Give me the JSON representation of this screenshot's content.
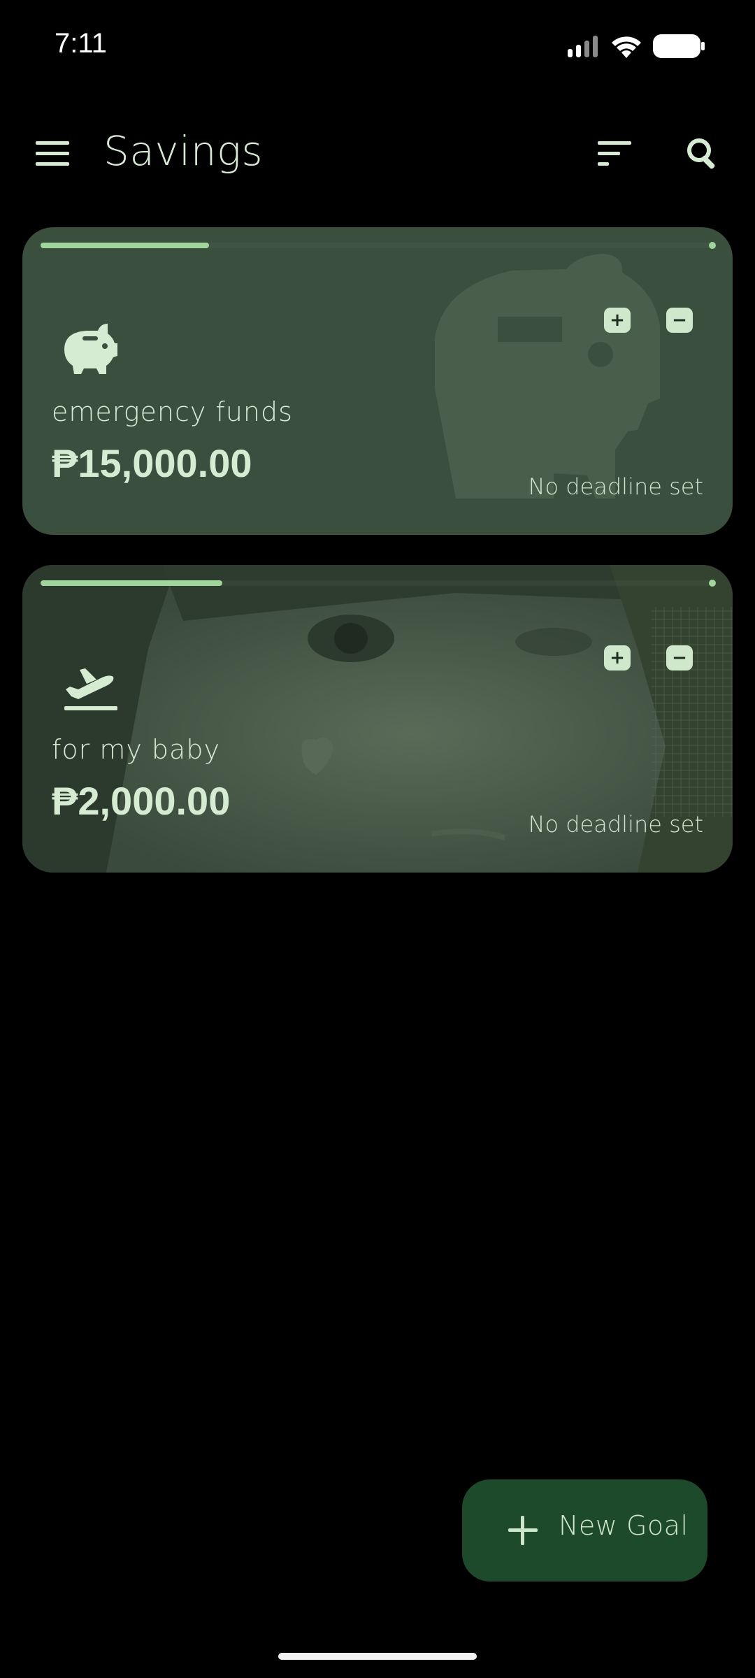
{
  "status_bar": {
    "time": "7:11",
    "icons": [
      "signal-icon",
      "wifi-icon",
      "battery-icon"
    ]
  },
  "app_bar": {
    "title": "Savings",
    "icons": {
      "menu": "hamburger-menu-icon",
      "sort": "sort-icon",
      "search": "search-icon"
    }
  },
  "goals": [
    {
      "name": "emergency funds",
      "amount": "₱15,000.00",
      "deadline": "No deadline set",
      "icon": "piggy-bank-icon",
      "background": "piggy-bank-illustration",
      "progress": 0.25,
      "increment_label": "+",
      "decrement_label": "−"
    },
    {
      "name": "for my baby",
      "amount": "₱2,000.00",
      "deadline": "No deadline set",
      "icon": "flight-takeoff-icon",
      "background": "photo",
      "progress": 0.27,
      "increment_label": "+",
      "decrement_label": "−"
    }
  ],
  "fab": {
    "label": "New Goal",
    "icon": "plus-icon"
  },
  "colors": {
    "background": "#000000",
    "card": "#3b4f3e",
    "accent": "#9fd69a",
    "text": "#d6ecd2",
    "fab": "#1d4a2a"
  }
}
